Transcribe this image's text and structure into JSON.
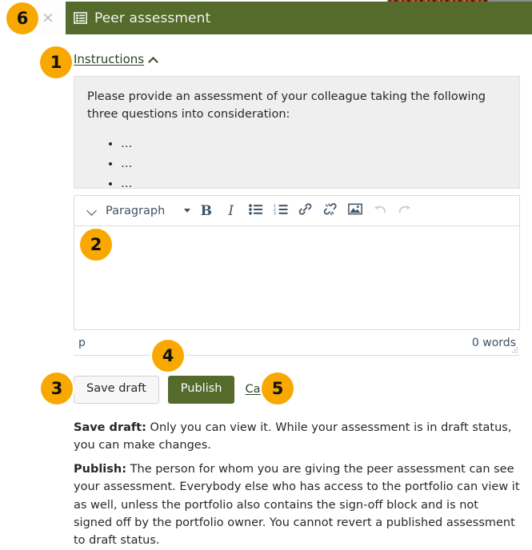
{
  "header": {
    "close_label": "×",
    "icon": "list-alt-icon",
    "title": "Peer assessment",
    "bar_color": "#546b2b"
  },
  "instructions": {
    "toggle_label": "Instructions",
    "toggle_icon": "chevron-up-icon",
    "expanded": true,
    "intro": "Please provide an assessment of your colleague taking the following three questions into consideration:",
    "bullets": [
      "…",
      "…",
      "…"
    ]
  },
  "editor": {
    "toolbar": {
      "collapse_icon": "chevron-down-icon",
      "format_label": "Paragraph",
      "format_caret_icon": "caret-down-icon",
      "bold_label": "B",
      "italic_label": "I",
      "bullet_list_icon": "unordered-list-icon",
      "numbered_list_icon": "ordered-list-icon",
      "link_icon": "link-icon",
      "unlink_icon": "unlink-icon",
      "image_icon": "image-icon",
      "undo_icon": "undo-arrow-icon",
      "redo_icon": "redo-arrow-icon"
    },
    "content": "",
    "placeholder": "",
    "status": {
      "element_path": "p",
      "word_count": "0 words",
      "resize_handle": "resize-grip-icon"
    }
  },
  "actions": {
    "save_draft_label": "Save draft",
    "publish_label": "Publish",
    "cancel_label": "Cancel"
  },
  "help": {
    "save_draft_term": "Save draft:",
    "save_draft_text": " Only you can view it. While your assessment is in draft status, you can make changes.",
    "publish_term": "Publish:",
    "publish_text": " The person for whom you are giving the peer assessment can see your assessment. Everybody else who has access to the portfolio can view it as well, unless the portfolio also contains the sign-off block and is not signed off by the portfolio owner. You cannot revert a published assessment to draft status."
  },
  "callouts": {
    "one": "1",
    "two": "2",
    "three": "3",
    "four": "4",
    "five": "5",
    "six": "6",
    "color": "#f8a800"
  }
}
